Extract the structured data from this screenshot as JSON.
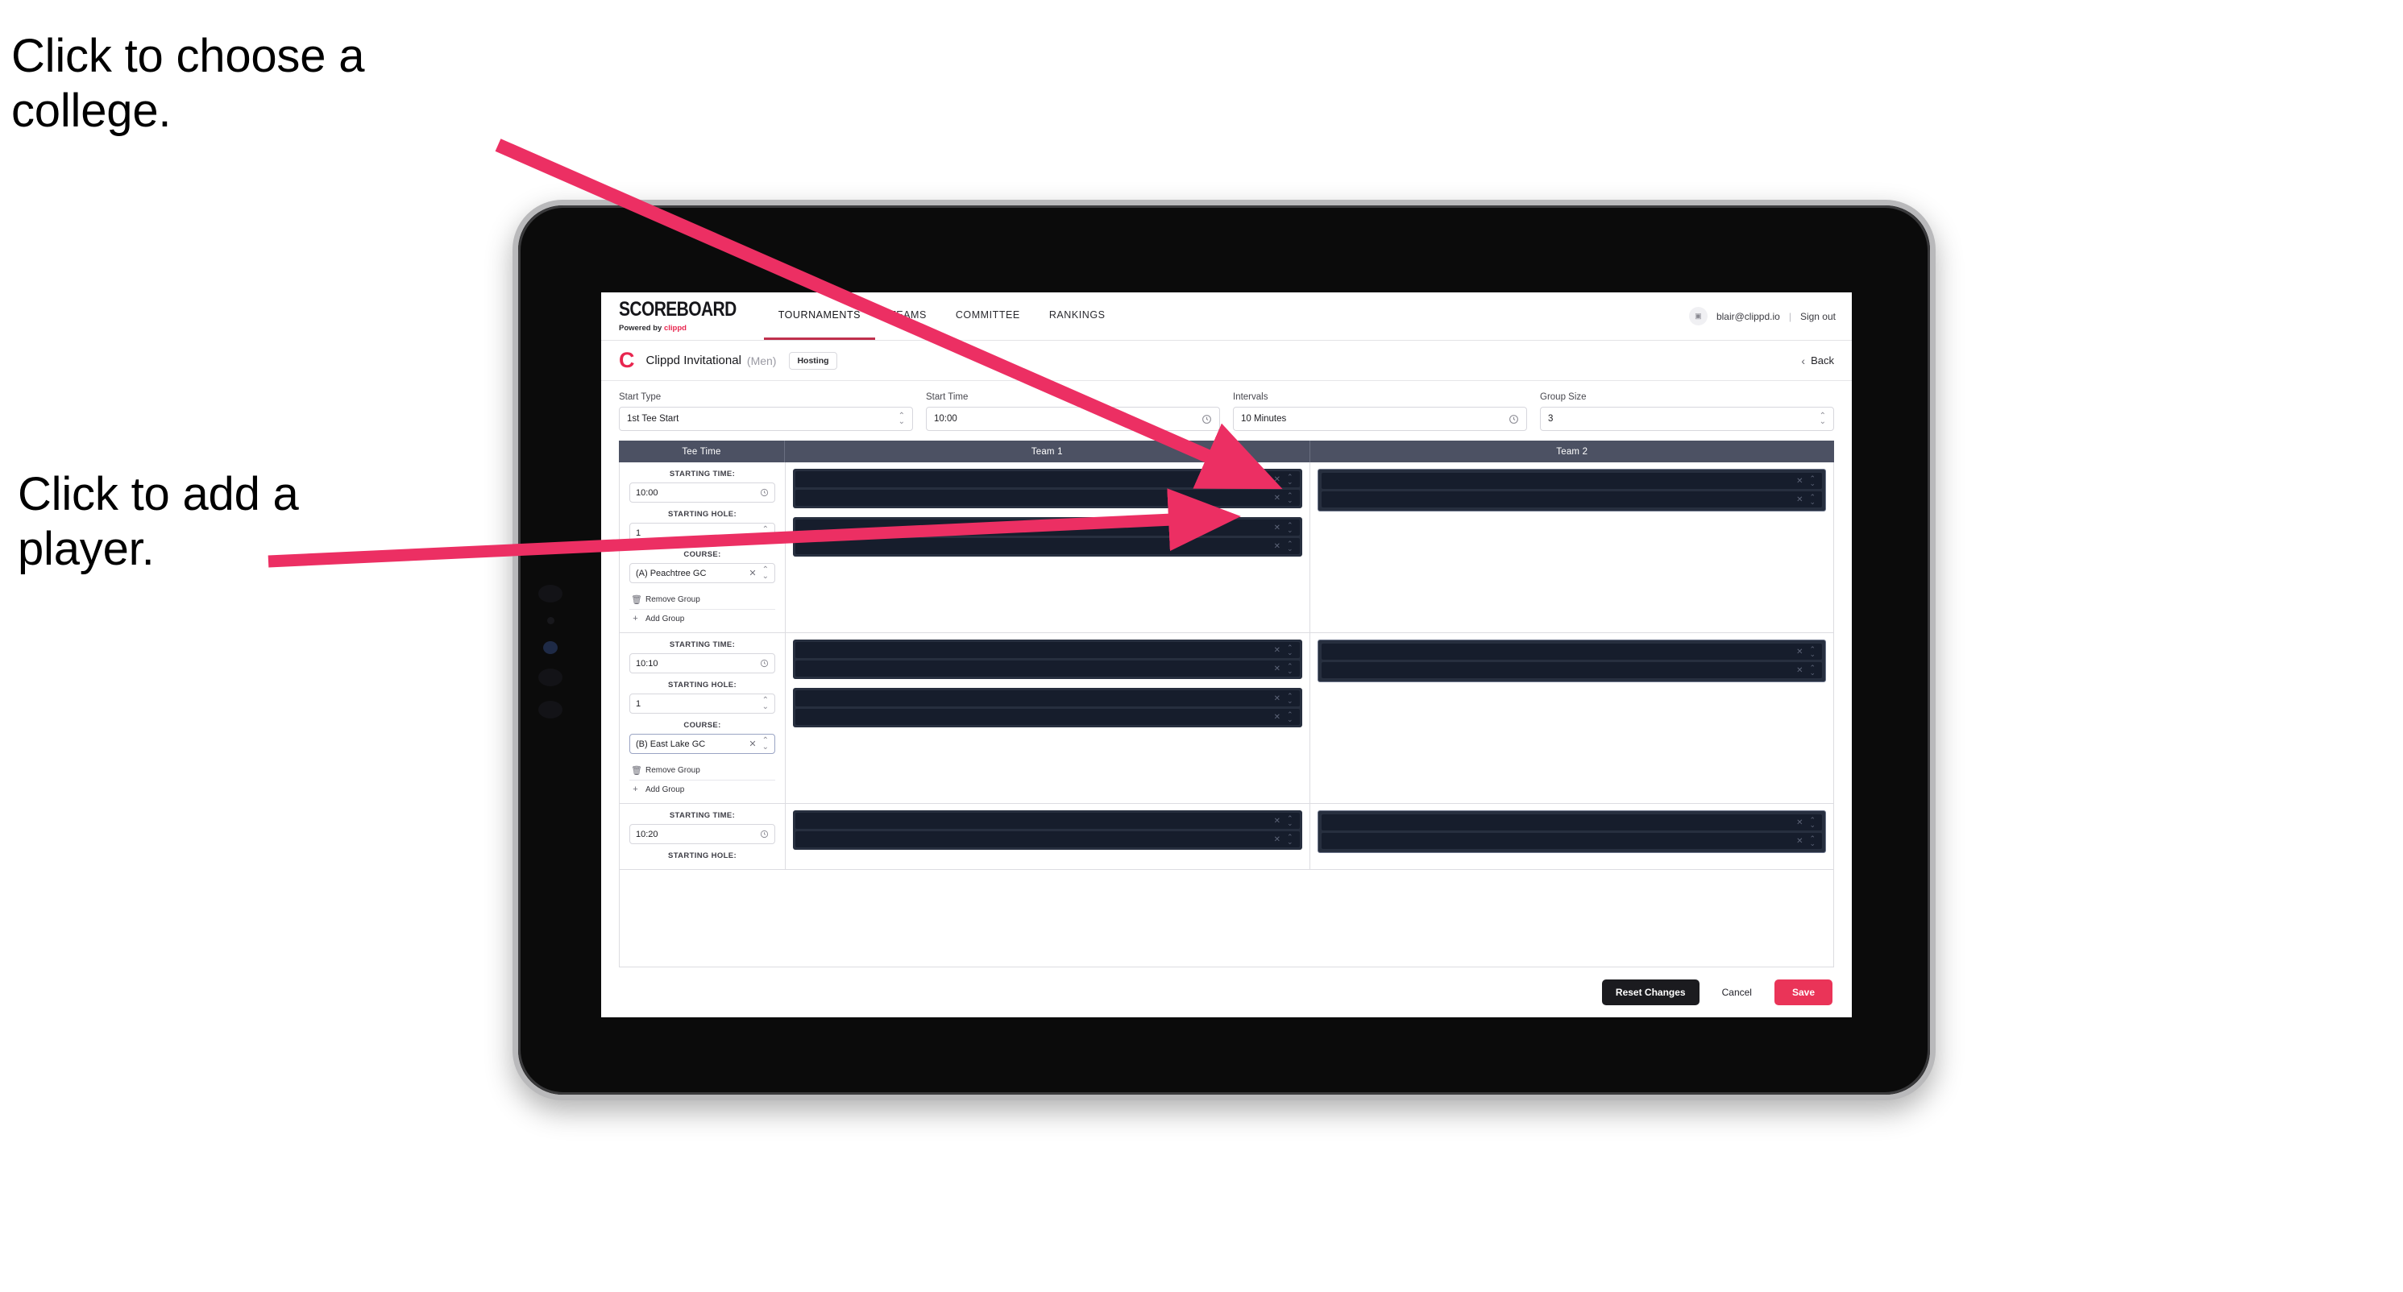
{
  "annotations": {
    "college": "Click to choose a college.",
    "player": "Click to add a player."
  },
  "app": {
    "brand": {
      "wordmark": "SCOREBOARD",
      "powered_prefix": "Powered by",
      "powered_accent": "clippd"
    },
    "nav": [
      {
        "label": "TOURNAMENTS",
        "active": true
      },
      {
        "label": "TEAMS",
        "active": false
      },
      {
        "label": "COMMITTEE",
        "active": false
      },
      {
        "label": "RANKINGS",
        "active": false
      }
    ],
    "account": {
      "avatar_icon": "user-icon",
      "email": "blair@clippd.io",
      "separator": "|",
      "sign_out": "Sign out"
    },
    "subheader": {
      "logo": "C",
      "tournament": "Clippd Invitational",
      "gender": "(Men)",
      "status_chip": "Hosting",
      "back_chevron": "‹",
      "back_label": "Back"
    },
    "controls": [
      {
        "label": "Start Type",
        "value": "1st Tee Start",
        "icon": "stepper-icon"
      },
      {
        "label": "Start Time",
        "value": "10:00",
        "icon": "clock-icon"
      },
      {
        "label": "Intervals",
        "value": "10 Minutes",
        "icon": "clock-icon"
      },
      {
        "label": "Group Size",
        "value": "3",
        "icon": "stepper-icon"
      }
    ],
    "table": {
      "headers": {
        "tee_time": "Tee Time",
        "team1": "Team 1",
        "team2": "Team 2"
      },
      "field_labels": {
        "starting_time": "STARTING TIME:",
        "starting_hole": "STARTING HOLE:",
        "course": "COURSE:"
      },
      "group_actions": {
        "remove": "Remove Group",
        "remove_icon": "trash-icon",
        "add": "Add Group",
        "add_icon": "plus-icon"
      },
      "rows": [
        {
          "starting_time": "10:00",
          "starting_hole": "1",
          "course": "(A) Peachtree GC",
          "course_focused": false,
          "team1_groups": [
            {
              "slots": 2,
              "outlined": false
            },
            {
              "slots": 2,
              "outlined": false
            }
          ],
          "team2_groups": [
            {
              "slots": 2,
              "outlined": true
            }
          ]
        },
        {
          "starting_time": "10:10",
          "starting_hole": "1",
          "course": "(B) East Lake GC",
          "course_focused": true,
          "team1_groups": [
            {
              "slots": 2,
              "outlined": false
            },
            {
              "slots": 2,
              "outlined": false
            }
          ],
          "team2_groups": [
            {
              "slots": 2,
              "outlined": true
            }
          ]
        },
        {
          "starting_time": "10:20",
          "starting_hole": "",
          "course": "",
          "course_focused": false,
          "team1_groups": [
            {
              "slots": 2,
              "outlined": false
            }
          ],
          "team2_groups": [
            {
              "slots": 2,
              "outlined": true
            }
          ]
        }
      ],
      "slot_clear_icon": "close-icon",
      "slot_stepper_icon": "stepper-icon"
    },
    "footer": {
      "reset": "Reset Changes",
      "cancel": "Cancel",
      "save": "Save"
    }
  },
  "colors": {
    "accent_pink": "#ea3458",
    "annotation_arrow": "#ec2f63",
    "table_header": "#4c5163",
    "slot_dark": "#161d2c",
    "group_dark": "#272f3f"
  }
}
